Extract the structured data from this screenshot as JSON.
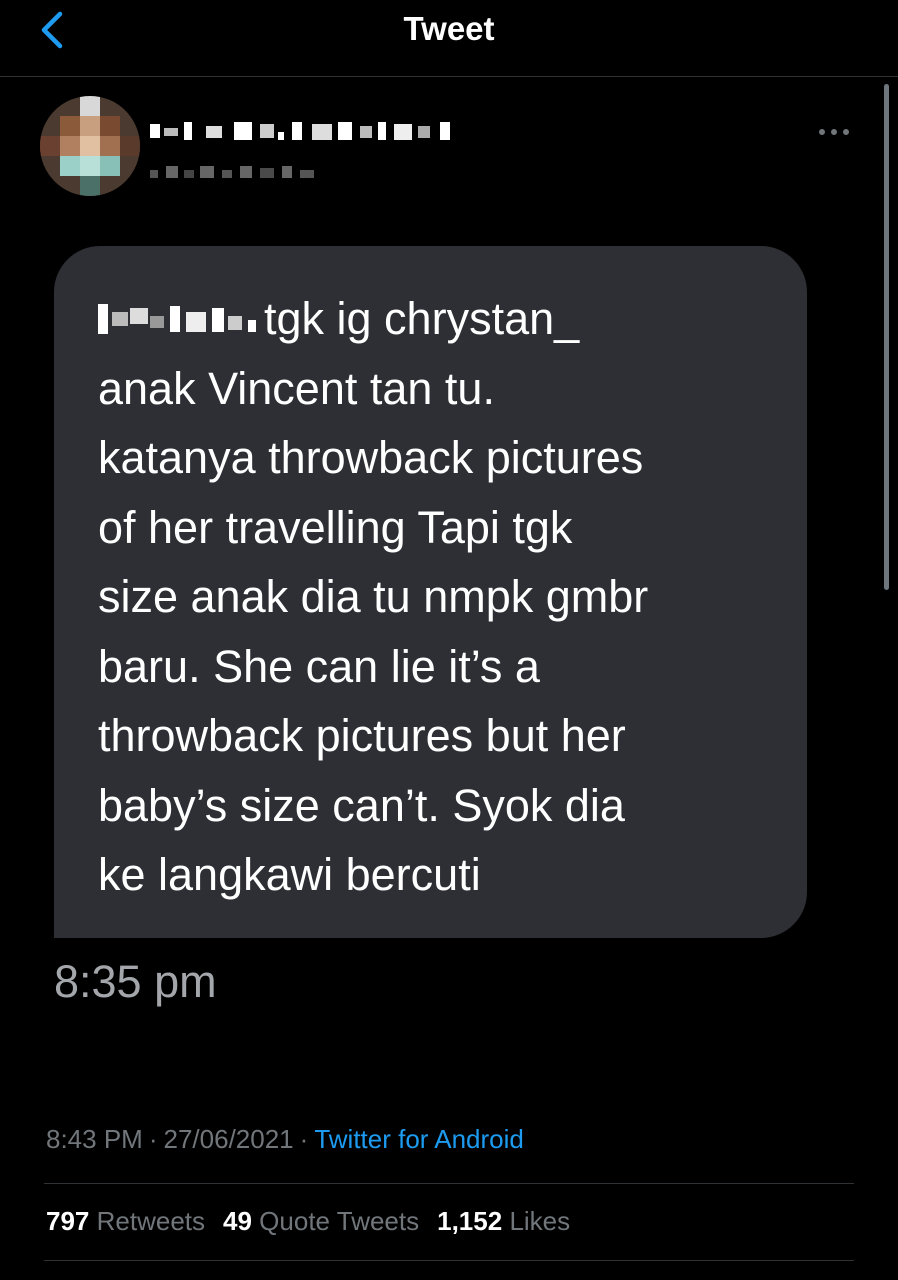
{
  "header": {
    "title": "Tweet",
    "back_icon": "chevron-left-icon",
    "accent_color": "#1d9bf0"
  },
  "author": {
    "avatar_icon": "avatar-pixelated",
    "more_icon": "more-horizontal-icon"
  },
  "message": {
    "text": "tgk ig chrystan_\nanak Vincent tan tu.\nkatanya throwback pictures\nof her travelling Tapi tgk\nsize anak dia tu nmpk gmbr\nbaru. She can lie it’s a\nthrowback pictures but her\nbaby’s size can’t. Syok dia\nke langkawi bercuti",
    "time": "8:35 pm",
    "bubble_color": "#2d2f34"
  },
  "meta": {
    "time": "8:43 PM",
    "separator": "·",
    "date": "27/06/2021",
    "source": "Twitter for Android"
  },
  "stats": {
    "retweets": {
      "count": "797",
      "label": "Retweets"
    },
    "quotes": {
      "count": "49",
      "label": "Quote Tweets"
    },
    "likes": {
      "count": "1,152",
      "label": "Likes"
    }
  }
}
